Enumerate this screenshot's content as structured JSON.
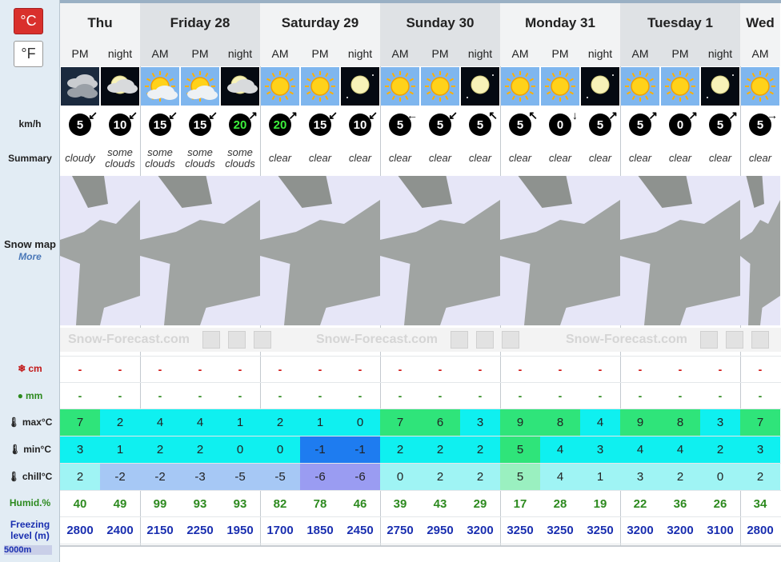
{
  "units": {
    "celsius": "°C",
    "fahrenheit": "°F"
  },
  "labels": {
    "wind": "km/h",
    "summary": "Summary",
    "snow_map": "Snow map",
    "more": "More",
    "snow": "cm",
    "rain": "mm",
    "max": "max°C",
    "min": "min°C",
    "chill": "chill°C",
    "humid": "Humid.%",
    "freezing": "Freezing level (m)",
    "freezing_sub": "5000m"
  },
  "days": [
    {
      "name": "Thu",
      "periods": 2
    },
    {
      "name": "Friday 28",
      "periods": 3
    },
    {
      "name": "Saturday 29",
      "periods": 3
    },
    {
      "name": "Sunday 30",
      "periods": 3
    },
    {
      "name": "Monday 31",
      "periods": 3
    },
    {
      "name": "Tuesday 1",
      "periods": 3
    },
    {
      "name": "Wed",
      "periods": 1
    }
  ],
  "periods": [
    "PM",
    "night",
    "AM",
    "PM",
    "night",
    "AM",
    "PM",
    "night",
    "AM",
    "PM",
    "night",
    "AM",
    "PM",
    "night",
    "AM",
    "PM",
    "night",
    "AM"
  ],
  "weather_icons": [
    "cloudy-icon",
    "moon-cloud-icon",
    "sun-cloud-icon",
    "sun-cloud-icon",
    "moon-cloud-icon",
    "sun-icon",
    "sun-icon",
    "moon-icon",
    "sun-icon",
    "sun-icon",
    "moon-icon",
    "sun-icon",
    "sun-icon",
    "moon-icon",
    "sun-icon",
    "sun-icon",
    "moon-icon",
    "sun-icon"
  ],
  "wind": [
    "5",
    "10",
    "15",
    "15",
    "20",
    "20",
    "15",
    "10",
    "5",
    "5",
    "5",
    "5",
    "0",
    "5",
    "5",
    "0",
    "5",
    "5"
  ],
  "wind_green": [
    false,
    false,
    false,
    false,
    true,
    true,
    false,
    false,
    false,
    false,
    false,
    false,
    false,
    false,
    false,
    false,
    false,
    false
  ],
  "summary": [
    "cloudy",
    "some clouds",
    "some clouds",
    "some clouds",
    "some clouds",
    "clear",
    "clear",
    "clear",
    "clear",
    "clear",
    "clear",
    "clear",
    "clear",
    "clear",
    "clear",
    "clear",
    "clear",
    "clear"
  ],
  "watermark": "Snow-Forecast.com",
  "snow": [
    "-",
    "-",
    "-",
    "-",
    "-",
    "-",
    "-",
    "-",
    "-",
    "-",
    "-",
    "-",
    "-",
    "-",
    "-",
    "-",
    "-",
    "-"
  ],
  "rain": [
    "-",
    "-",
    "-",
    "-",
    "-",
    "-",
    "-",
    "-",
    "-",
    "-",
    "-",
    "-",
    "-",
    "-",
    "-",
    "-",
    "-",
    "-"
  ],
  "tmax": [
    "7",
    "2",
    "4",
    "4",
    "1",
    "2",
    "1",
    "0",
    "7",
    "6",
    "3",
    "9",
    "8",
    "4",
    "9",
    "8",
    "3",
    "7"
  ],
  "tmin": [
    "3",
    "1",
    "2",
    "2",
    "0",
    "0",
    "-1",
    "-1",
    "2",
    "2",
    "2",
    "5",
    "4",
    "3",
    "4",
    "4",
    "2",
    "3"
  ],
  "tchill": [
    "2",
    "-2",
    "-2",
    "-3",
    "-5",
    "-5",
    "-6",
    "-6",
    "0",
    "2",
    "2",
    "5",
    "4",
    "1",
    "3",
    "2",
    "0",
    "2"
  ],
  "humid": [
    "40",
    "49",
    "99",
    "93",
    "93",
    "82",
    "78",
    "46",
    "39",
    "43",
    "29",
    "17",
    "28",
    "19",
    "22",
    "36",
    "26",
    "34"
  ],
  "freezing": [
    "2800",
    "2400",
    "2150",
    "2250",
    "1950",
    "1700",
    "1850",
    "2450",
    "2750",
    "2950",
    "3200",
    "3250",
    "3250",
    "3250",
    "3200",
    "3200",
    "3100",
    "2800"
  ],
  "colors": {
    "c_green": "#2fe47a",
    "c_cyan": "#0ff0f0",
    "c_ltcyan": "#9ff4f4",
    "c_blue": "#1e7cf0",
    "c_ltblue": "#a6c8f5",
    "c_lav": "#9a9cf2",
    "c_ltgreen": "#9af0c0"
  },
  "tmax_colors": [
    "c_green",
    "c_cyan",
    "c_cyan",
    "c_cyan",
    "c_cyan",
    "c_cyan",
    "c_cyan",
    "c_cyan",
    "c_green",
    "c_green",
    "c_cyan",
    "c_green",
    "c_green",
    "c_cyan",
    "c_green",
    "c_green",
    "c_cyan",
    "c_green"
  ],
  "tmin_colors": [
    "c_cyan",
    "c_cyan",
    "c_cyan",
    "c_cyan",
    "c_cyan",
    "c_cyan",
    "c_blue",
    "c_blue",
    "c_cyan",
    "c_cyan",
    "c_cyan",
    "c_green",
    "c_cyan",
    "c_cyan",
    "c_cyan",
    "c_cyan",
    "c_cyan",
    "c_cyan"
  ],
  "tchill_colors": [
    "c_ltcyan",
    "c_ltblue",
    "c_ltblue",
    "c_ltblue",
    "c_ltblue",
    "c_ltblue",
    "c_lav",
    "c_lav",
    "c_ltcyan",
    "c_ltcyan",
    "c_ltcyan",
    "c_ltgreen",
    "c_ltcyan",
    "c_ltcyan",
    "c_ltcyan",
    "c_ltcyan",
    "c_ltcyan",
    "c_ltcyan"
  ]
}
